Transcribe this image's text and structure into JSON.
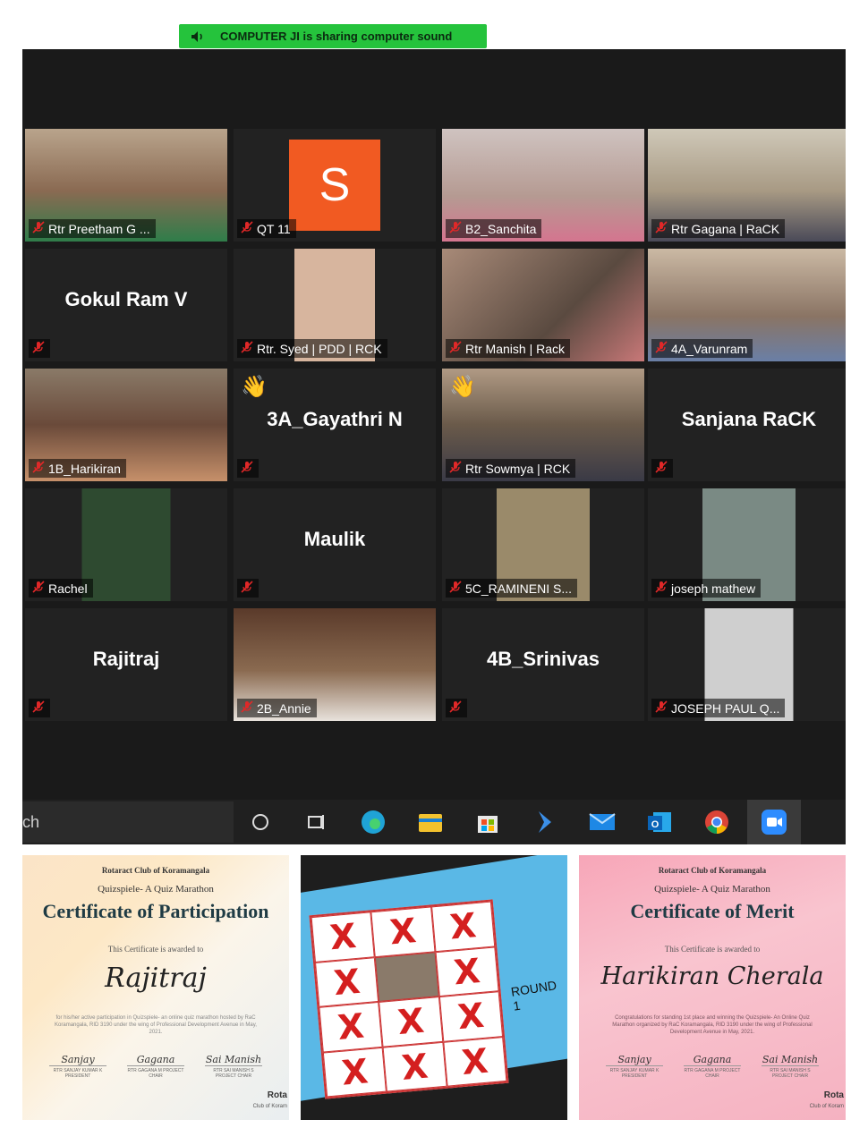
{
  "banner": {
    "text": "COMPUTER JI is sharing computer sound"
  },
  "tiles": [
    {
      "label": "Rtr Preetham G ...",
      "kind": "video"
    },
    {
      "label": "QT 11",
      "kind": "avatar",
      "avatar_letter": "S"
    },
    {
      "label": "B2_Sanchita",
      "kind": "video"
    },
    {
      "label": "Rtr Gagana | RaCK",
      "kind": "video",
      "active": true
    },
    {
      "label": "Gokul Ram V",
      "kind": "name"
    },
    {
      "label": "Rtr. Syed | PDD | RCK",
      "kind": "video"
    },
    {
      "label": "Rtr Manish | Rack",
      "kind": "video"
    },
    {
      "label": "4A_Varunram",
      "kind": "video"
    },
    {
      "label": "1B_Harikiran",
      "kind": "video"
    },
    {
      "label": "3A_Gayathri N",
      "kind": "name",
      "hand": true
    },
    {
      "label": "Rtr Sowmya | RCK",
      "kind": "video",
      "hand": true
    },
    {
      "label": "Sanjana RaCK",
      "kind": "name"
    },
    {
      "label": "Rachel",
      "kind": "video"
    },
    {
      "label": "Maulik",
      "kind": "name"
    },
    {
      "label": "5C_RAMINENI S...",
      "kind": "video"
    },
    {
      "label": "joseph mathew",
      "kind": "video"
    },
    {
      "label": "Rajitraj",
      "kind": "name"
    },
    {
      "label": "2B_Annie",
      "kind": "video"
    },
    {
      "label": "4B_Srinivas",
      "kind": "name"
    },
    {
      "label": "JOSEPH PAUL Q...",
      "kind": "video"
    }
  ],
  "taskbar": {
    "search_text": "ch",
    "icons": [
      "task-view-icon",
      "widgets-icon",
      "edge-icon",
      "file-explorer-icon",
      "store-icon",
      "power-automate-icon",
      "mail-icon",
      "outlook-icon",
      "chrome-icon",
      "zoom-icon"
    ]
  },
  "cert_participation": {
    "club": "Rotaract Club of Koramangala",
    "event": "Quizspiele- A Quiz Marathon",
    "title": "Certificate of Participation",
    "awarded": "This Certificate is awarded to",
    "recipient": "Rajitraj",
    "blurb": "for his/her active participation in Quizspiele- an online quiz marathon hosted by RaC Koramangala, RID 3190 under the wing of Professional Development Avenue in May, 2021.",
    "signers": [
      {
        "sig": "Sanjay",
        "role": "RTR SANJAY KUMAR K PRESIDENT"
      },
      {
        "sig": "Gagana",
        "role": "RTR GAGANA M PROJECT CHAIR"
      },
      {
        "sig": "Sai Manish",
        "role": "RTR SAI MANISH S PROJECT CHAIR"
      }
    ],
    "footer1": "Rota",
    "footer2": "Club of Koram"
  },
  "quiz_card": {
    "round_text": "ROUND 1",
    "marks": [
      "X",
      "X",
      "X",
      "X",
      "",
      "X",
      "X",
      "X",
      "X",
      "X",
      "X",
      "X"
    ]
  },
  "cert_merit": {
    "club": "Rotaract Club of Koramangala",
    "event": "Quizspiele- A Quiz Marathon",
    "title": "Certificate of Merit",
    "awarded": "This Certificate is awarded to",
    "recipient": "Harikiran Cherala",
    "blurb": "Congratulations for standing 1st place and winning the Quizspiele- An Online Quiz Marathon organized by RaC Koramangala, RID 3190 under the wing of Professional Development Avenue in May, 2021.",
    "signers": [
      {
        "sig": "Sanjay",
        "role": "RTR SANJAY KUMAR K PRESIDENT"
      },
      {
        "sig": "Gagana",
        "role": "RTR GAGANA M PROJECT CHAIR"
      },
      {
        "sig": "Sai Manish",
        "role": "RTR SAI MANISH S PROJECT CHAIR"
      }
    ],
    "footer1": "Rota",
    "footer2": "Club of Koram"
  }
}
